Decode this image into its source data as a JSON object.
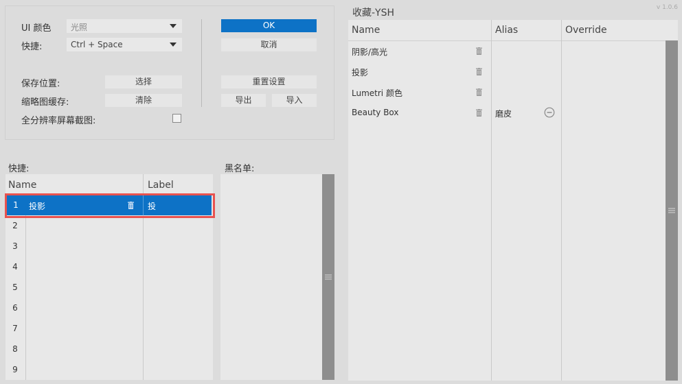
{
  "version": "v 1.0.6",
  "settings": {
    "ui_color_label": "UI 颜色",
    "ui_color_value": "光照",
    "shortcut_label": "快捷:",
    "shortcut_value": "Ctrl + Space",
    "save_location_label": "保存位置:",
    "thumbnail_cache_label": "缩略图缓存:",
    "fullres_screenshot_label": "全分辨率屏幕截图:",
    "select_button": "选择",
    "clear_button": "清除",
    "ok_button": "OK",
    "cancel_button": "取消",
    "reset_button": "重置设置",
    "export_button": "导出",
    "import_button": "导入",
    "fullres_checked": false
  },
  "shortcuts": {
    "title": "快捷:",
    "columns": {
      "name": "Name",
      "label": "Label"
    },
    "rows": [
      {
        "num": "1",
        "name": "投影",
        "label": "投",
        "selected": true
      },
      {
        "num": "2",
        "name": "",
        "label": ""
      },
      {
        "num": "3",
        "name": "",
        "label": ""
      },
      {
        "num": "4",
        "name": "",
        "label": ""
      },
      {
        "num": "5",
        "name": "",
        "label": ""
      },
      {
        "num": "6",
        "name": "",
        "label": ""
      },
      {
        "num": "7",
        "name": "",
        "label": ""
      },
      {
        "num": "8",
        "name": "",
        "label": ""
      },
      {
        "num": "9",
        "name": "",
        "label": ""
      }
    ]
  },
  "blacklist": {
    "title": "黑名单:"
  },
  "favorites": {
    "title": "收藏-YSH",
    "columns": {
      "name": "Name",
      "alias": "Alias",
      "override": "Override"
    },
    "items": [
      {
        "name": "阴影/高光",
        "alias": ""
      },
      {
        "name": "投影",
        "alias": ""
      },
      {
        "name": "Lumetri 颜色",
        "alias": ""
      },
      {
        "name": "Beauty Box",
        "alias": "磨皮"
      }
    ]
  },
  "colors": {
    "accent": "#0d72c6",
    "highlight_border": "#e8524f",
    "background": "#dcdcdc"
  },
  "icons": [
    "dropdown-caret-icon",
    "trash-icon",
    "remove-circle-icon",
    "scroll-grip-icon"
  ]
}
